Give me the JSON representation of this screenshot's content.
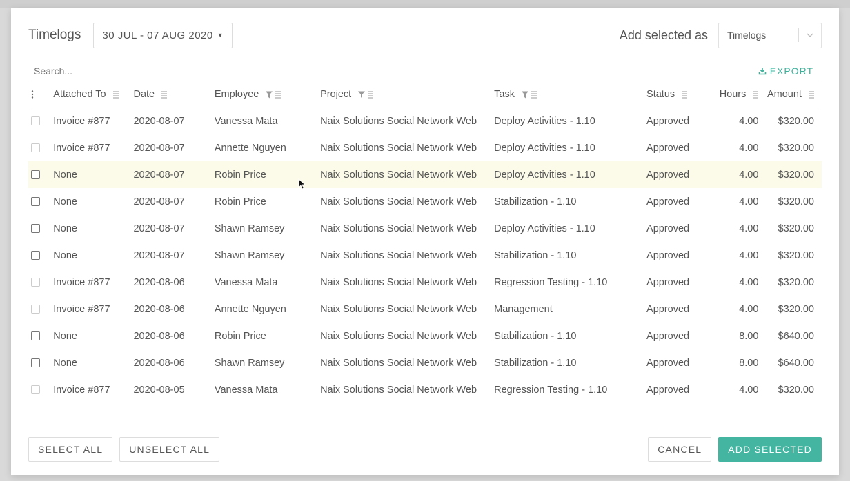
{
  "header": {
    "title": "Timelogs",
    "date_range": "30 JUL - 07 AUG 2020",
    "add_selected_as_label": "Add selected as",
    "add_selected_as_value": "Timelogs"
  },
  "search": {
    "placeholder": "Search...",
    "export_label": "EXPORT"
  },
  "table": {
    "columns": [
      "Attached To",
      "Date",
      "Employee",
      "Project",
      "Task",
      "Status",
      "Hours",
      "Amount"
    ],
    "rows": [
      {
        "attached_to": "Invoice #877",
        "date": "2020-08-07",
        "employee": "Vanessa Mata",
        "project": "Naix Solutions Social Network Web",
        "task": "Deploy Activities - 1.10",
        "status": "Approved",
        "hours": "4.00",
        "amount": "$320.00"
      },
      {
        "attached_to": "Invoice #877",
        "date": "2020-08-07",
        "employee": "Annette Nguyen",
        "project": "Naix Solutions Social Network Web",
        "task": "Deploy Activities - 1.10",
        "status": "Approved",
        "hours": "4.00",
        "amount": "$320.00"
      },
      {
        "attached_to": "None",
        "date": "2020-08-07",
        "employee": "Robin Price",
        "project": "Naix Solutions Social Network Web",
        "task": "Deploy Activities - 1.10",
        "status": "Approved",
        "hours": "4.00",
        "amount": "$320.00"
      },
      {
        "attached_to": "None",
        "date": "2020-08-07",
        "employee": "Robin Price",
        "project": "Naix Solutions Social Network Web",
        "task": "Stabilization - 1.10",
        "status": "Approved",
        "hours": "4.00",
        "amount": "$320.00"
      },
      {
        "attached_to": "None",
        "date": "2020-08-07",
        "employee": "Shawn Ramsey",
        "project": "Naix Solutions Social Network Web",
        "task": "Deploy Activities - 1.10",
        "status": "Approved",
        "hours": "4.00",
        "amount": "$320.00"
      },
      {
        "attached_to": "None",
        "date": "2020-08-07",
        "employee": "Shawn Ramsey",
        "project": "Naix Solutions Social Network Web",
        "task": "Stabilization - 1.10",
        "status": "Approved",
        "hours": "4.00",
        "amount": "$320.00"
      },
      {
        "attached_to": "Invoice #877",
        "date": "2020-08-06",
        "employee": "Vanessa Mata",
        "project": "Naix Solutions Social Network Web",
        "task": "Regression Testing - 1.10",
        "status": "Approved",
        "hours": "4.00",
        "amount": "$320.00"
      },
      {
        "attached_to": "Invoice #877",
        "date": "2020-08-06",
        "employee": "Annette Nguyen",
        "project": "Naix Solutions Social Network Web",
        "task": "Management",
        "status": "Approved",
        "hours": "4.00",
        "amount": "$320.00"
      },
      {
        "attached_to": "None",
        "date": "2020-08-06",
        "employee": "Robin Price",
        "project": "Naix Solutions Social Network Web",
        "task": "Stabilization - 1.10",
        "status": "Approved",
        "hours": "8.00",
        "amount": "$640.00"
      },
      {
        "attached_to": "None",
        "date": "2020-08-06",
        "employee": "Shawn Ramsey",
        "project": "Naix Solutions Social Network Web",
        "task": "Stabilization - 1.10",
        "status": "Approved",
        "hours": "8.00",
        "amount": "$640.00"
      },
      {
        "attached_to": "Invoice #877",
        "date": "2020-08-05",
        "employee": "Vanessa Mata",
        "project": "Naix Solutions Social Network Web",
        "task": "Regression Testing - 1.10",
        "status": "Approved",
        "hours": "4.00",
        "amount": "$320.00"
      }
    ]
  },
  "footer": {
    "select_all": "SELECT ALL",
    "unselect_all": "UNSELECT ALL",
    "cancel": "CANCEL",
    "add_selected": "ADD SELECTED"
  },
  "colors": {
    "accent": "#44b5a0",
    "export": "#3fb19b",
    "hover_row": "#fcfbea"
  },
  "icons": [
    "caret-down-icon",
    "chevron-down-icon",
    "download-icon",
    "column-menu-icon",
    "filter-icon",
    "more-vertical-icon",
    "mouse-cursor-icon"
  ]
}
